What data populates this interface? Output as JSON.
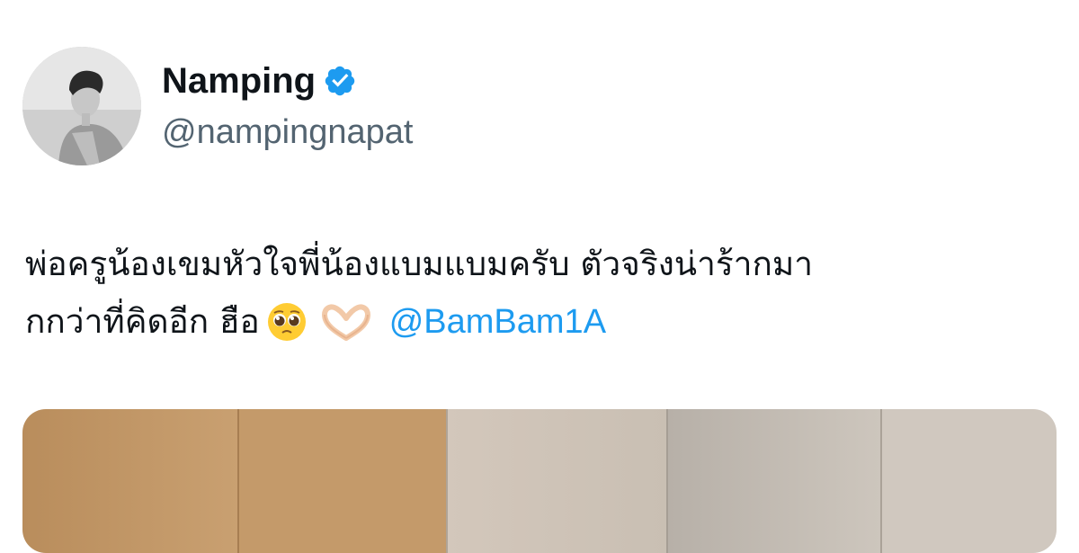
{
  "tweet": {
    "author": {
      "display_name": "Namping",
      "handle": "@nampingnapat",
      "verified": true,
      "verified_color": "#1d9bf0",
      "avatar_icon": "profile-photo"
    },
    "text": {
      "line1": "พ่อครูน้องเขมหัวใจพี่น้องแบมแบมครับ ตัวจริงน่าร้ากมา",
      "line2": "กกว่าที่คิดอีก ฮือ",
      "emojis": [
        "pleading-face-emoji",
        "heart-hands-emoji"
      ],
      "mention": "@BamBam1A"
    },
    "colors": {
      "text": "#0f1419",
      "secondary": "#536471",
      "link": "#1d9bf0"
    },
    "media": {
      "type": "photo"
    }
  }
}
